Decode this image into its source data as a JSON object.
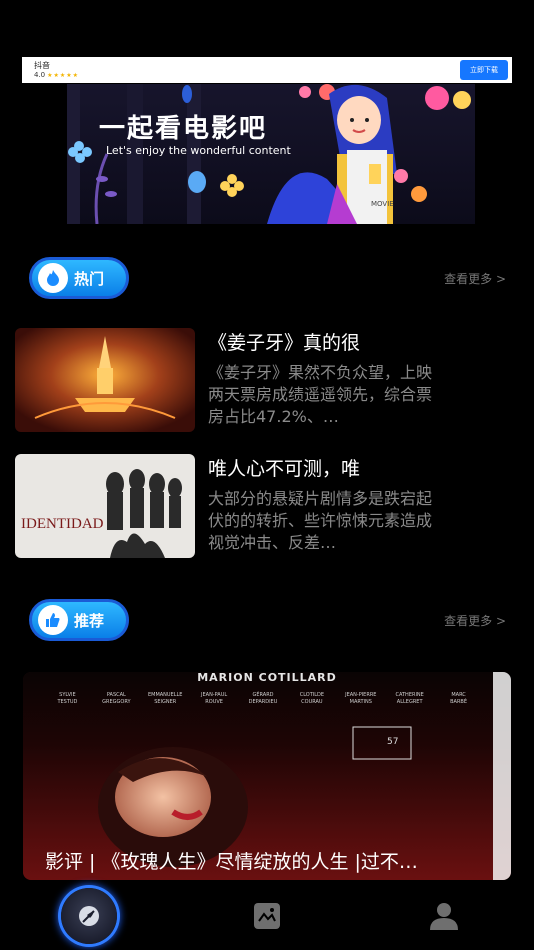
{
  "ad": {
    "app_name": "抖音",
    "rating": "4.0",
    "download_label": "立即下载"
  },
  "banner": {
    "title": "一起看电影吧",
    "subtitle": "Let's enjoy the wonderful content",
    "badge": "MOVIE"
  },
  "hot": {
    "title": "热门",
    "more": "查看更多 >"
  },
  "news": [
    {
      "title": "《姜子牙》真的很",
      "desc": "《姜子牙》果然不负众望，上映两天票房成绩遥遥领先，综合票房占比47.2%、…"
    },
    {
      "title": "唯人心不可测，唯",
      "desc": "大部分的悬疑片剧情多是跌宕起伏的的转折、些许惊悚元素造成视觉冲击、反差…",
      "thumb_text": "IDENTIDAD"
    }
  ],
  "recommend": {
    "title": "推荐",
    "more": "查看更多 >"
  },
  "feature": {
    "poster_name": "MARION COTILLARD",
    "cast": [
      "SYLVIE TESTUD",
      "PASCAL GREGGORY",
      "EMMANUELLE SEIGNER",
      "JEAN-PAUL ROUVE",
      "GÉRARD DEPARDIEU",
      "CLOTILDE COURAU",
      "JEAN-PIERRE MARTINS",
      "CATHERINE ALLEGRET",
      "MARC BARBÉ"
    ],
    "caption": "影评 | 《玫瑰人生》尽情绽放的人生 |过不…"
  },
  "tabs": [
    "discover",
    "gallery",
    "profile"
  ],
  "colors": {
    "accent": "#1a8cff",
    "background": "#000000",
    "muted": "#8a8a8a"
  }
}
